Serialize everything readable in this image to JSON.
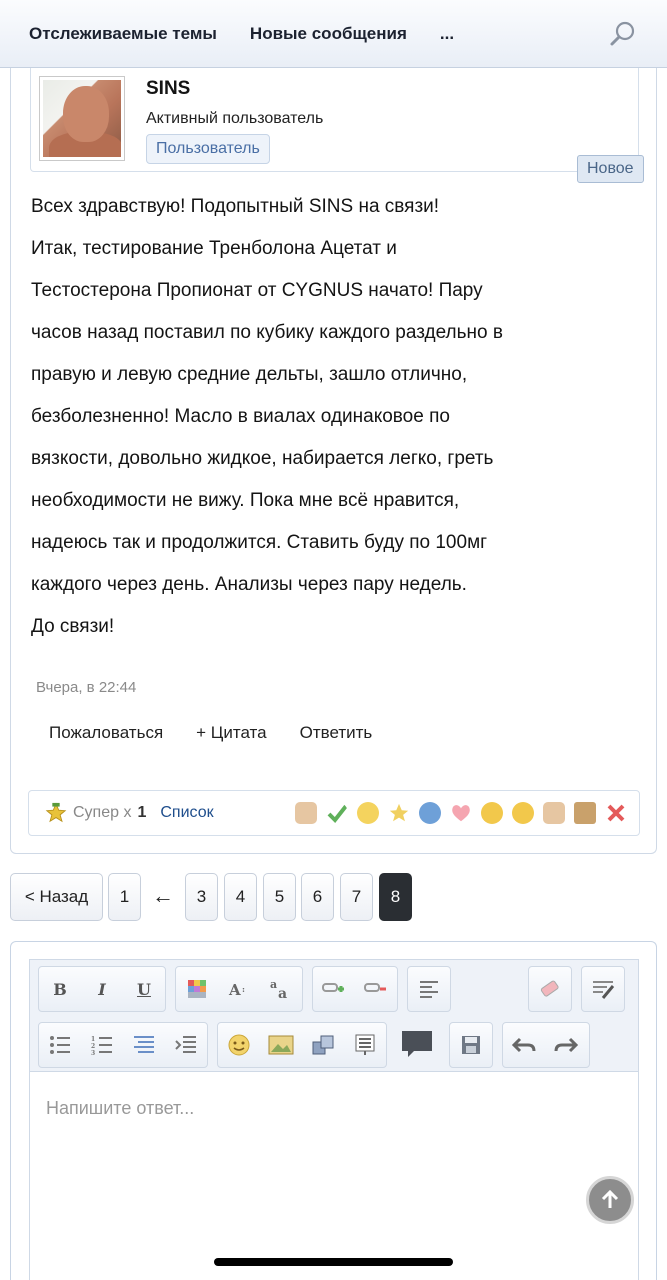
{
  "nav": {
    "watched_threads": "Отслеживаемые темы",
    "new_posts": "Новые сообщения",
    "more": "..."
  },
  "post": {
    "author": "SINS",
    "user_title": "Активный пользователь",
    "user_banner": "Пользователь",
    "new_badge": "Новое",
    "message_lines": [
      "Всех здравствую! Подопытный SINS на связи!",
      "Итак, тестирование Тренболона Ацетат и",
      "Тестостерона Пропионат от CYGNUS начато! Пару",
      "часов назад поставил по кубику каждого раздельно в",
      "правую и левую средние дельты, зашло отлично,",
      "безболезненно! Масло в виалах одинаковое по",
      "вязкости, довольно жидкое, набирается легко, греть",
      "необходимости не вижу. Пока мне всё нравится,",
      "надеюсь так и продолжится. Ставить буду по 100мг",
      "каждого через день. Анализы через пару недель.",
      "До связи!"
    ],
    "date": "Вчера, в 22:44",
    "actions": {
      "report": "Пожаловаться",
      "quote": "+ Цитата",
      "reply": "Ответить"
    },
    "likes": {
      "label": "Супер x",
      "count": "1",
      "list": "Список"
    }
  },
  "pagination": {
    "prev": "< Назад",
    "pages": [
      "1",
      "3",
      "4",
      "5",
      "6",
      "7",
      "8"
    ],
    "jump": "←",
    "current": "8"
  },
  "editor": {
    "bold": "B",
    "italic": "I",
    "underline": "U",
    "placeholder": "Напишите ответ..."
  },
  "colors": {
    "accent": "#1f4e8c",
    "current_page": "#2a2e33"
  }
}
